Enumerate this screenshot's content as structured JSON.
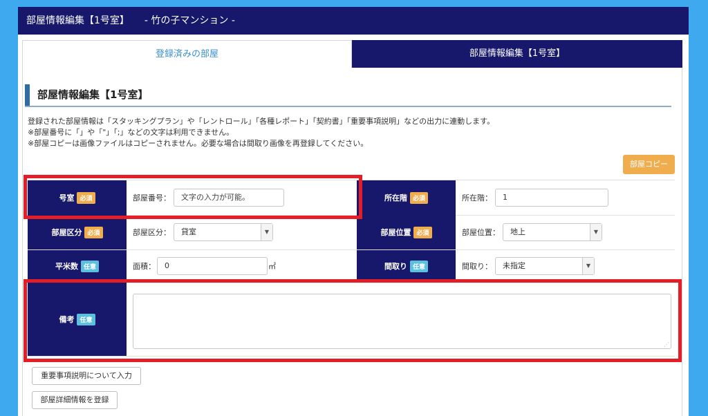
{
  "header": {
    "title": "部屋情報編集【1号室】",
    "subtitle": "- 竹の子マンション -"
  },
  "tabs": [
    {
      "label": "登録済みの部屋",
      "active": false
    },
    {
      "label": "部屋情報編集【1号室】",
      "active": true
    }
  ],
  "section": {
    "title": "部屋情報編集【1号室】",
    "notes": [
      "登録された部屋情報は「スタッキングプラン」や「レントロール」「各種レポート」「契約書」「重要事項説明」などの出力に連動します。",
      "※部屋番号に「」や「\"」「;」などの文字は利用できません。",
      "※部屋コピーは画像ファイルはコピーされません。必要な場合は間取り画像を再登録してください。"
    ],
    "copy_button": "部屋コピー"
  },
  "badges": {
    "required": "必須",
    "optional": "任意"
  },
  "form": {
    "room_no": {
      "label": "号室",
      "field_label": "部屋番号：",
      "placeholder": "文字の入力が可能。"
    },
    "floor": {
      "label": "所在階",
      "field_label": "所在階：",
      "value": "1"
    },
    "room_type": {
      "label": "部屋区分",
      "field_label": "部屋区分：",
      "value": "貸室"
    },
    "room_position": {
      "label": "部屋位置",
      "field_label": "部屋位置：",
      "value": "地上"
    },
    "area": {
      "label": "平米数",
      "field_label": "面積：",
      "value": "0",
      "unit": "㎡"
    },
    "layout": {
      "label": "間取り",
      "field_label": "間取り：",
      "value": "未指定"
    },
    "remarks": {
      "label": "備考",
      "value": ""
    }
  },
  "buttons": {
    "important_matters": "重要事項説明について入力",
    "register_details": "部屋詳細情報を登録"
  },
  "colors": {
    "navy": "#17186b",
    "accent_blue": "#3fa9ef",
    "required": "#f0ad4e",
    "optional": "#5bc0de",
    "highlight": "#e41e26"
  }
}
